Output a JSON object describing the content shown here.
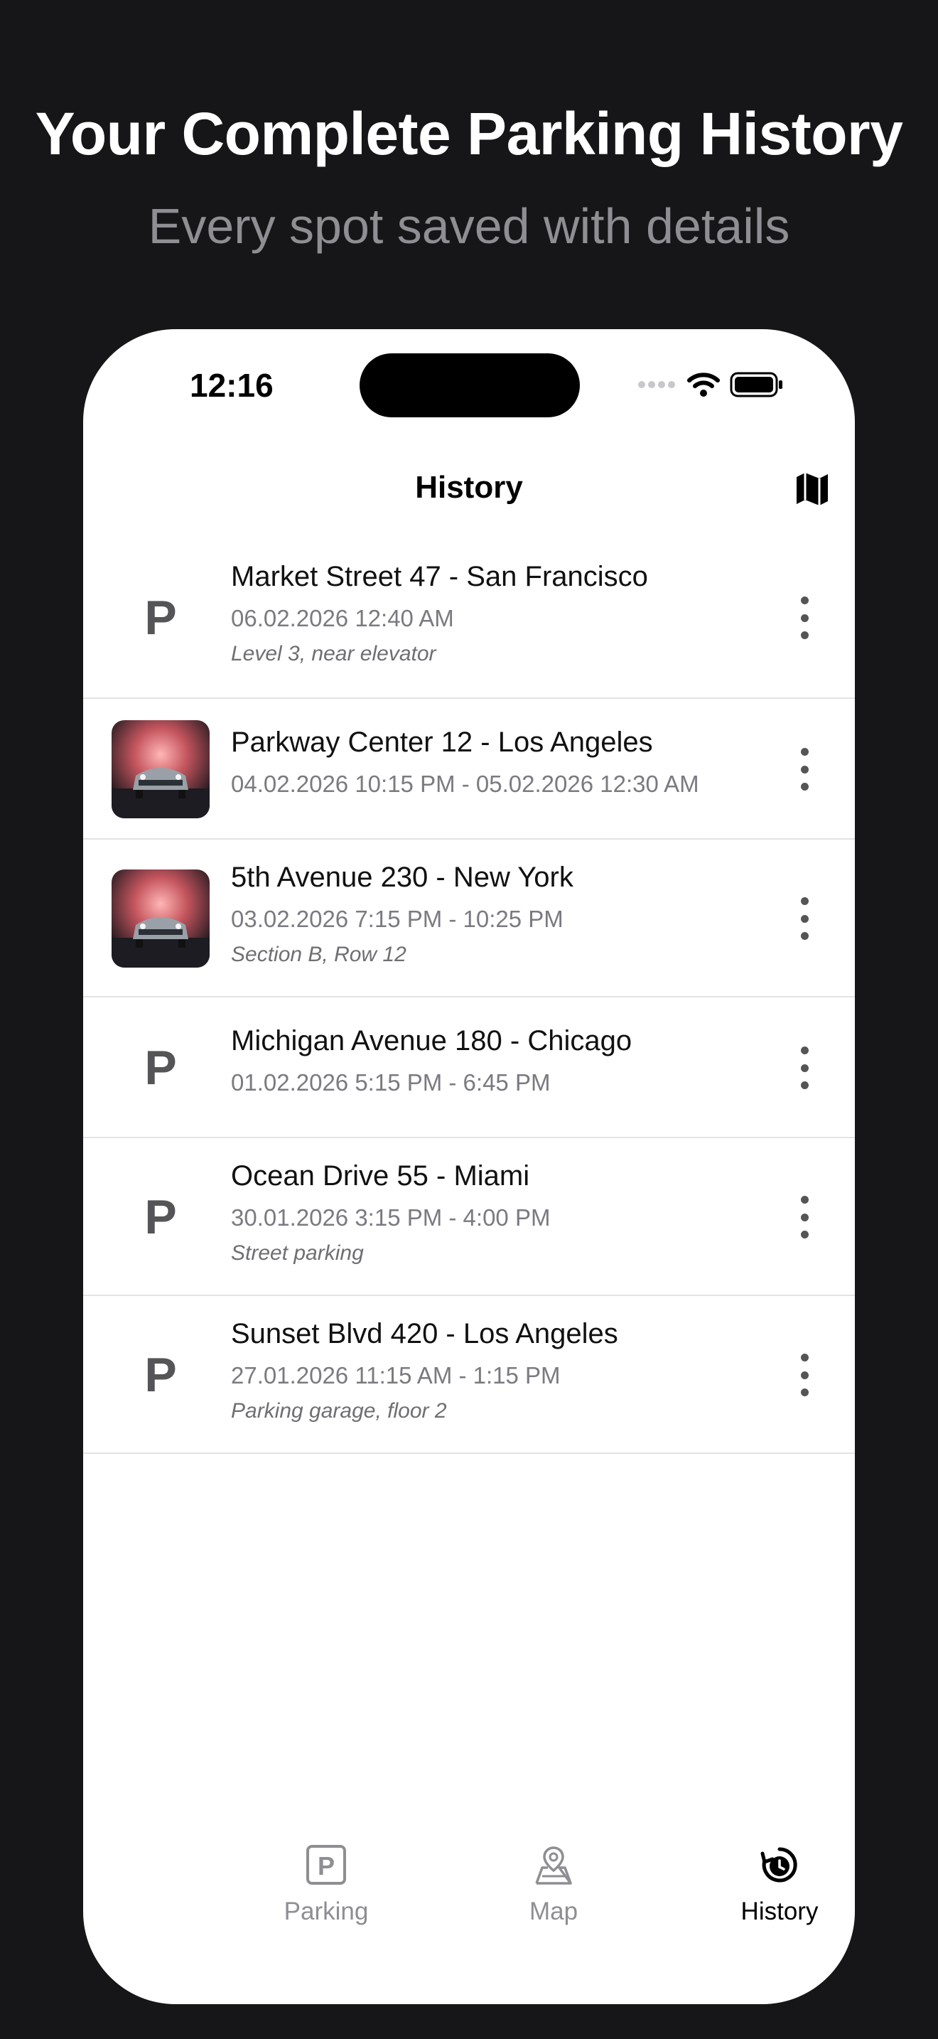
{
  "promo": {
    "headline": "Your Complete Parking History",
    "subline": "Every spot saved with details"
  },
  "status_bar": {
    "time": "12:16"
  },
  "nav": {
    "title": "History",
    "map_icon": "map-icon"
  },
  "history": [
    {
      "title": "Market Street 47 - San Francisco",
      "date": "06.02.2026 12:40 AM",
      "note": "Level 3, near elevator",
      "has_photo": false
    },
    {
      "title": "Parkway Center 12 - Los Angeles",
      "date": "04.02.2026 10:15 PM - 05.02.2026 12:30 AM",
      "note": "",
      "has_photo": true
    },
    {
      "title": "5th Avenue 230 - New York",
      "date": "03.02.2026 7:15 PM - 10:25 PM",
      "note": "Section B, Row 12",
      "has_photo": true
    },
    {
      "title": "Michigan Avenue 180 - Chicago",
      "date": "01.02.2026 5:15 PM - 6:45 PM",
      "note": "",
      "has_photo": false
    },
    {
      "title": "Ocean Drive 55 - Miami",
      "date": "30.01.2026 3:15 PM - 4:00 PM",
      "note": "Street parking",
      "has_photo": false
    },
    {
      "title": "Sunset Blvd 420 - Los Angeles",
      "date": "27.01.2026 11:15 AM - 1:15 PM",
      "note": "Parking garage, floor 2",
      "has_photo": false
    }
  ],
  "parking_glyph": "P",
  "tabs": [
    {
      "label": "Parking",
      "icon": "parking-icon",
      "active": false
    },
    {
      "label": "Map",
      "icon": "map-pin-icon",
      "active": false
    },
    {
      "label": "History",
      "icon": "history-icon",
      "active": true
    }
  ],
  "colors": {
    "background": "#161618",
    "card": "#ffffff",
    "muted": "#8e8e93",
    "text": "#000000"
  }
}
